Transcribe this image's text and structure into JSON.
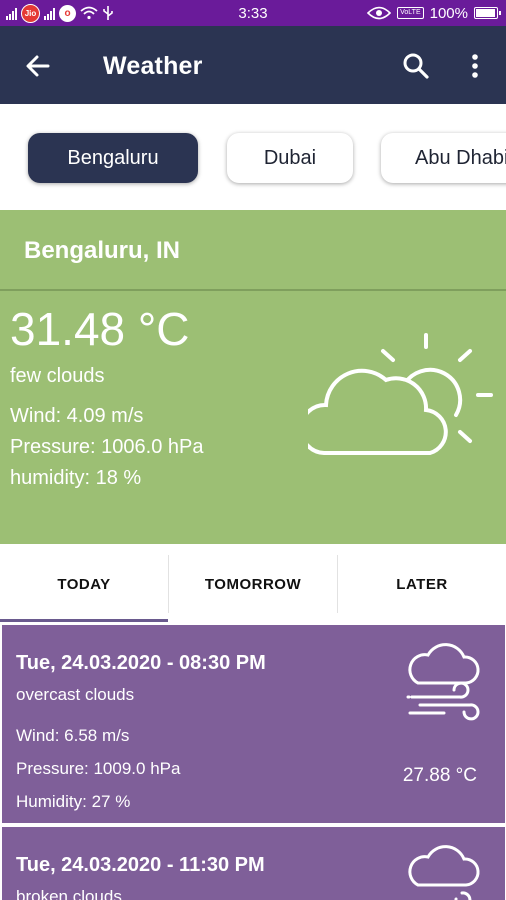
{
  "status_bar": {
    "carrier_badge": "Jio",
    "carrier2_badge": "o",
    "time": "3:33",
    "volte": "VoLTE",
    "battery": "100%",
    "battery_level": 1.0
  },
  "app_bar": {
    "title": "Weather",
    "back_icon": "arrow-left-icon",
    "search_icon": "search-icon",
    "more_icon": "more-vert-icon"
  },
  "cities": [
    {
      "label": "Bengaluru",
      "active": true
    },
    {
      "label": "Dubai",
      "active": false
    },
    {
      "label": "Abu Dhabi",
      "active": false
    }
  ],
  "current": {
    "location": "Bengaluru, IN",
    "temperature": "31.48 °C",
    "condition": "few clouds",
    "wind": "Wind: 4.09 m/s",
    "pressure": "Pressure: 1006.0 hPa",
    "humidity": "humidity: 18 %",
    "icon": "partly-cloudy-icon",
    "background": "#9cbf74"
  },
  "tabs": [
    {
      "label": "TODAY",
      "selected": true
    },
    {
      "label": "TOMORROW",
      "selected": false
    },
    {
      "label": "LATER",
      "selected": false
    }
  ],
  "forecast": [
    {
      "date": "Tue, 24.03.2020 - 08:30 PM",
      "condition": "overcast clouds",
      "wind": "Wind: 6.58 m/s",
      "pressure": "Pressure: 1009.0 hPa",
      "humidity": "Humidity: 27 %",
      "temperature": "27.88 °C",
      "icon": "cloud-wind-icon"
    },
    {
      "date": "Tue, 24.03.2020 - 11:30 PM",
      "condition": "broken clouds",
      "icon": "cloud-wind-icon"
    }
  ],
  "colors": {
    "status_bar": "#6a1b9a",
    "app_bar": "#2b3452",
    "current_card": "#9cbf74",
    "forecast_card": "#7f5f99"
  }
}
